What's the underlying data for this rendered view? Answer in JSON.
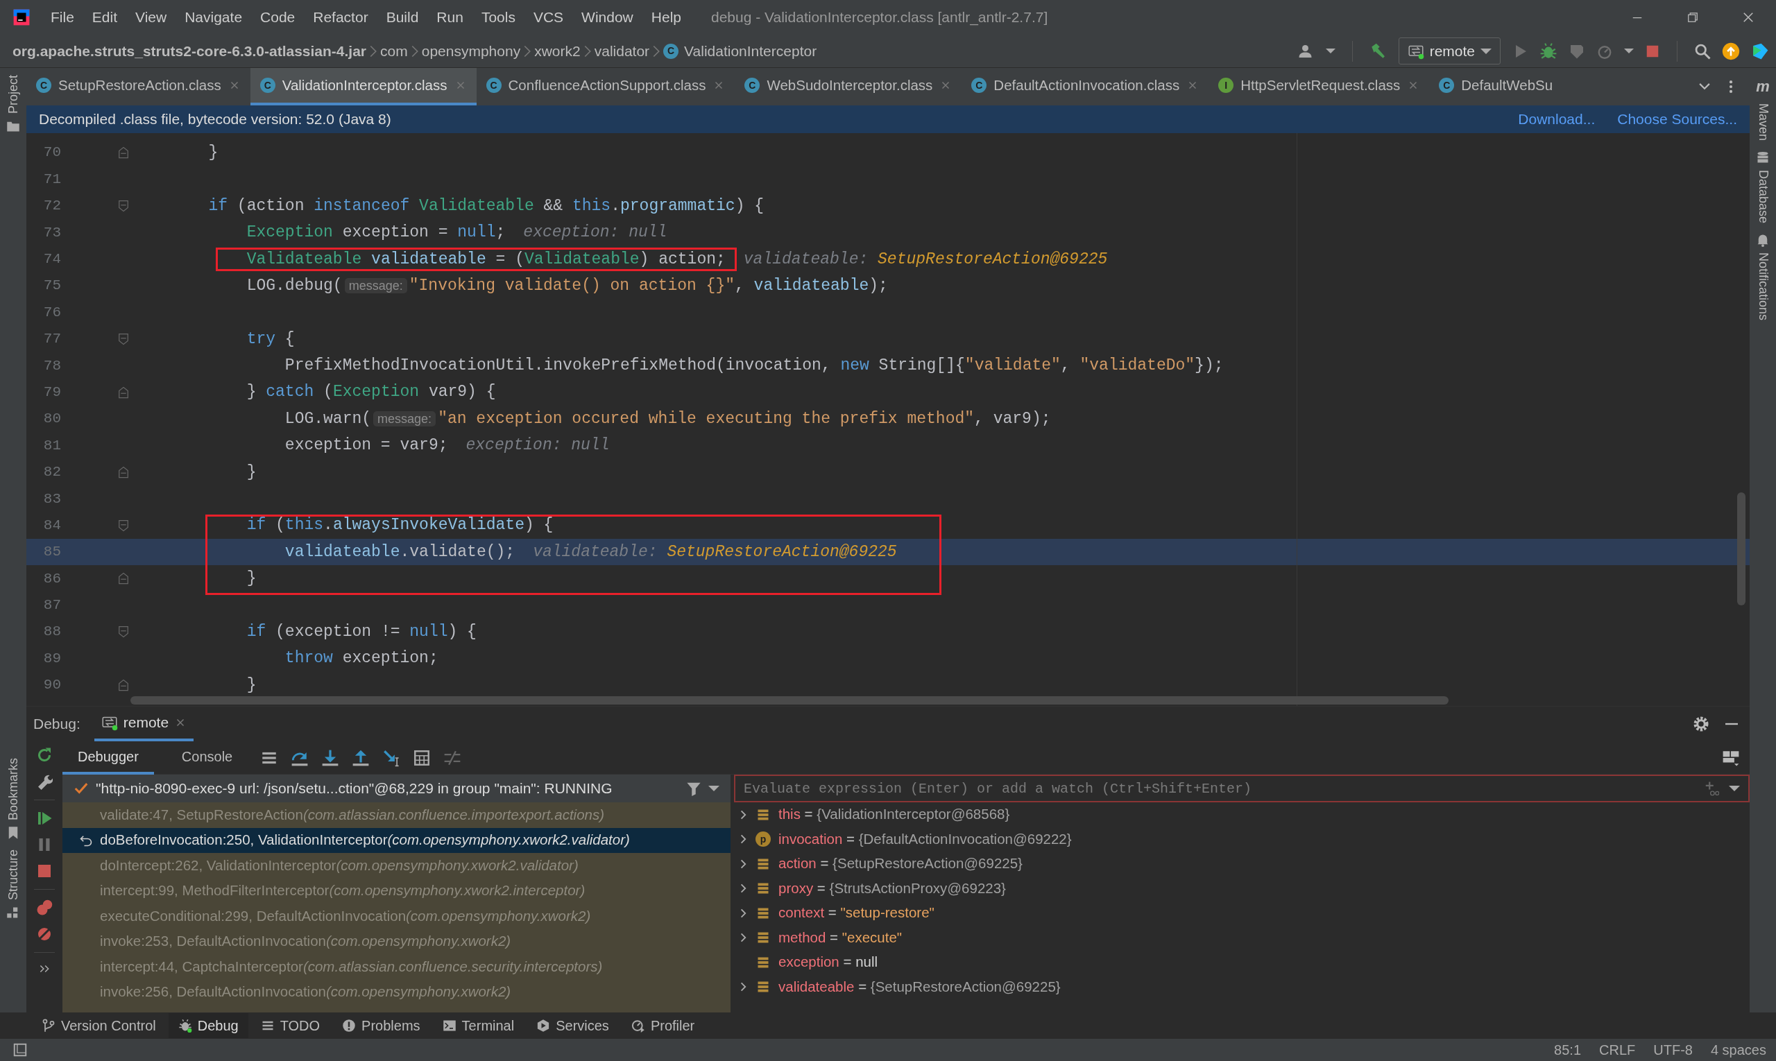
{
  "window": {
    "title": "debug - ValidationInterceptor.class [antlr_antlr-2.7.7]"
  },
  "menu": [
    "File",
    "Edit",
    "View",
    "Navigate",
    "Code",
    "Refactor",
    "Build",
    "Run",
    "Tools",
    "VCS",
    "Window",
    "Help"
  ],
  "breadcrumb": [
    {
      "label": "org.apache.struts_struts2-core-6.3.0-atlassian-4.jar"
    },
    {
      "label": "com"
    },
    {
      "label": "opensymphony"
    },
    {
      "label": "xwork2"
    },
    {
      "label": "validator"
    },
    {
      "label": "ValidationInterceptor",
      "kind": "class",
      "icon_letter": "C"
    }
  ],
  "run_config": "remote",
  "editor_tabs": [
    {
      "label": "SetupRestoreAction.class",
      "kind": "class",
      "icon_letter": "C",
      "selected": false,
      "closable": true
    },
    {
      "label": "ValidationInterceptor.class",
      "kind": "class",
      "icon_letter": "C",
      "selected": true,
      "closable": true
    },
    {
      "label": "ConfluenceActionSupport.class",
      "kind": "class",
      "icon_letter": "C",
      "selected": false,
      "closable": true
    },
    {
      "label": "WebSudoInterceptor.class",
      "kind": "class",
      "icon_letter": "C",
      "selected": false,
      "closable": true
    },
    {
      "label": "DefaultActionInvocation.class",
      "kind": "class",
      "icon_letter": "C",
      "selected": false,
      "closable": true
    },
    {
      "label": "HttpServletRequest.class",
      "kind": "interface",
      "icon_letter": "I",
      "selected": false,
      "closable": true
    },
    {
      "label": "DefaultWebSu",
      "kind": "class",
      "icon_letter": "C",
      "selected": false,
      "closable": false
    }
  ],
  "banner": {
    "text": "Decompiled .class file, bytecode version: 52.0 (Java 8)",
    "links": [
      "Download...",
      "Choose Sources..."
    ]
  },
  "code_lines": [
    {
      "number": "70",
      "fold_start": false,
      "fold_end": true,
      "current": false,
      "boxed": false,
      "tokens": [
        {
          "kind": "plain",
          "text": "        }"
        }
      ]
    },
    {
      "number": "71",
      "fold_start": false,
      "fold_end": false,
      "current": false,
      "boxed": false
    },
    {
      "number": "72",
      "fold_start": true,
      "fold_end": false,
      "current": false,
      "boxed": false,
      "tokens": [
        {
          "kind": "keyword",
          "text": "        if"
        },
        {
          "kind": "plain",
          "text": " (action "
        },
        {
          "kind": "keyword",
          "text": "instanceof "
        },
        {
          "kind": "type",
          "text": "Validateable"
        },
        {
          "kind": "plain",
          "text": " && "
        },
        {
          "kind": "keyword",
          "text": "this"
        },
        {
          "kind": "plain",
          "text": "."
        },
        {
          "kind": "field",
          "text": "programmatic"
        },
        {
          "kind": "plain",
          "text": ") {"
        }
      ]
    },
    {
      "number": "73",
      "fold_start": false,
      "fold_end": false,
      "current": false,
      "boxed": false,
      "tokens": [
        {
          "kind": "type",
          "text": "            Exception"
        },
        {
          "kind": "plain",
          "text": " exception = "
        },
        {
          "kind": "keyword",
          "text": "null"
        },
        {
          "kind": "plain",
          "text": ";"
        },
        {
          "kind": "inlay",
          "text": "exception: null"
        }
      ]
    },
    {
      "number": "74",
      "fold_start": false,
      "fold_end": false,
      "current": false,
      "boxed": true,
      "tokens": [
        {
          "kind": "type",
          "text": "            Validateable "
        },
        {
          "kind": "field",
          "text": "validateable"
        },
        {
          "kind": "plain",
          "text": " = ("
        },
        {
          "kind": "type",
          "text": "Validateable"
        },
        {
          "kind": "plain",
          "text": ") action;"
        },
        {
          "kind": "inlay",
          "text": "validateable:"
        },
        {
          "kind": "inlay_value",
          "text": "SetupRestoreAction@69225"
        }
      ]
    },
    {
      "number": "75",
      "fold_start": false,
      "fold_end": false,
      "current": false,
      "boxed": false,
      "tokens": [
        {
          "kind": "plain",
          "text": "            LOG.debug("
        },
        {
          "kind": "param",
          "text": "message:"
        },
        {
          "kind": "string",
          "text": "\"Invoking validate() on action {}\""
        },
        {
          "kind": "plain",
          "text": ", "
        },
        {
          "kind": "field",
          "text": "validateable"
        },
        {
          "kind": "plain",
          "text": ");"
        }
      ]
    },
    {
      "number": "76",
      "fold_start": false,
      "fold_end": false,
      "current": false,
      "boxed": false
    },
    {
      "number": "77",
      "fold_start": true,
      "fold_end": false,
      "current": false,
      "boxed": false,
      "tokens": [
        {
          "kind": "keyword",
          "text": "            try"
        },
        {
          "kind": "plain",
          "text": " {"
        }
      ]
    },
    {
      "number": "78",
      "fold_start": false,
      "fold_end": false,
      "current": false,
      "boxed": false,
      "tokens": [
        {
          "kind": "plain",
          "text": "                PrefixMethodInvocationUtil.invokePrefixMethod(invocation, "
        },
        {
          "kind": "keyword",
          "text": "new"
        },
        {
          "kind": "plain",
          "text": " String[]{"
        },
        {
          "kind": "string",
          "text": "\"validate\""
        },
        {
          "kind": "plain",
          "text": ", "
        },
        {
          "kind": "string",
          "text": "\"validateDo\""
        },
        {
          "kind": "plain",
          "text": "});"
        }
      ]
    },
    {
      "number": "79",
      "fold_start": false,
      "fold_end": true,
      "current": false,
      "boxed": false,
      "tokens": [
        {
          "kind": "plain",
          "text": "            } "
        },
        {
          "kind": "keyword",
          "text": "catch"
        },
        {
          "kind": "plain",
          "text": " ("
        },
        {
          "kind": "type",
          "text": "Exception"
        },
        {
          "kind": "plain",
          "text": " var9) {"
        }
      ]
    },
    {
      "number": "80",
      "fold_start": false,
      "fold_end": false,
      "current": false,
      "boxed": false,
      "tokens": [
        {
          "kind": "plain",
          "text": "                LOG.warn("
        },
        {
          "kind": "param",
          "text": "message:"
        },
        {
          "kind": "string",
          "text": "\"an exception occured while executing the prefix method\""
        },
        {
          "kind": "plain",
          "text": ", var9);"
        }
      ]
    },
    {
      "number": "81",
      "fold_start": false,
      "fold_end": false,
      "current": false,
      "boxed": false,
      "tokens": [
        {
          "kind": "plain",
          "text": "                exception = var9;"
        },
        {
          "kind": "inlay",
          "text": "exception: null"
        }
      ]
    },
    {
      "number": "82",
      "fold_start": false,
      "fold_end": true,
      "current": false,
      "boxed": false,
      "tokens": [
        {
          "kind": "plain",
          "text": "            }"
        }
      ]
    },
    {
      "number": "83",
      "fold_start": false,
      "fold_end": false,
      "current": false,
      "boxed": false
    },
    {
      "number": "84",
      "fold_start": true,
      "fold_end": false,
      "current": false,
      "boxed": true,
      "tokens": [
        {
          "kind": "keyword",
          "text": "            if"
        },
        {
          "kind": "plain",
          "text": " ("
        },
        {
          "kind": "keyword",
          "text": "this"
        },
        {
          "kind": "plain",
          "text": "."
        },
        {
          "kind": "field",
          "text": "alwaysInvokeValidate"
        },
        {
          "kind": "plain",
          "text": ") {"
        }
      ]
    },
    {
      "number": "85",
      "fold_start": false,
      "fold_end": false,
      "current": true,
      "boxed": true,
      "tokens": [
        {
          "kind": "field",
          "text": "                validateable"
        },
        {
          "kind": "plain",
          "text": ".validate();"
        },
        {
          "kind": "inlay",
          "text": "validateable:"
        },
        {
          "kind": "inlay_value",
          "text": "SetupRestoreAction@69225"
        }
      ]
    },
    {
      "number": "86",
      "fold_start": false,
      "fold_end": true,
      "current": false,
      "boxed": true,
      "tokens": [
        {
          "kind": "plain",
          "text": "            }"
        }
      ]
    },
    {
      "number": "87",
      "fold_start": false,
      "fold_end": false,
      "current": false,
      "boxed": false
    },
    {
      "number": "88",
      "fold_start": true,
      "fold_end": false,
      "current": false,
      "boxed": false,
      "tokens": [
        {
          "kind": "keyword",
          "text": "            if"
        },
        {
          "kind": "plain",
          "text": " (exception != "
        },
        {
          "kind": "keyword",
          "text": "null"
        },
        {
          "kind": "plain",
          "text": ") {"
        }
      ]
    },
    {
      "number": "89",
      "fold_start": false,
      "fold_end": false,
      "current": false,
      "boxed": false,
      "tokens": [
        {
          "kind": "keyword",
          "text": "                throw"
        },
        {
          "kind": "plain",
          "text": " exception;"
        }
      ]
    },
    {
      "number": "90",
      "fold_start": false,
      "fold_end": true,
      "current": false,
      "boxed": false,
      "tokens": [
        {
          "kind": "plain",
          "text": "            }"
        }
      ]
    }
  ],
  "left_stripe_top": [
    {
      "label": "Project",
      "kind": "project"
    }
  ],
  "left_stripe_bottom": [
    {
      "label": "Bookmarks",
      "kind": "bookmarks"
    },
    {
      "label": "Structure",
      "kind": "structure"
    }
  ],
  "right_stripe": [
    {
      "label": "Maven",
      "kind": "maven",
      "icon_letter": "m"
    },
    {
      "label": "Database",
      "kind": "database"
    },
    {
      "label": "Notifications",
      "kind": "notifications"
    }
  ],
  "debug": {
    "label": "Debug:",
    "session_tab": "remote",
    "tabs": [
      {
        "label": "Debugger",
        "selected": true
      },
      {
        "label": "Console",
        "selected": false
      }
    ],
    "thread": "\"http-nio-8090-exec-9 url: /json/setu...ction\"@68,229 in group \"main\": RUNNING",
    "frames": [
      {
        "location": "validate:47, SetupRestoreAction",
        "package": "(com.atlassian.confluence.importexport.actions)",
        "selected": false
      },
      {
        "location": "doBeforeInvocation:250, ValidationInterceptor",
        "package": "(com.opensymphony.xwork2.validator)",
        "selected": true
      },
      {
        "location": "doIntercept:262, ValidationInterceptor",
        "package": "(com.opensymphony.xwork2.validator)",
        "selected": false
      },
      {
        "location": "intercept:99, MethodFilterInterceptor",
        "package": "(com.opensymphony.xwork2.interceptor)",
        "selected": false
      },
      {
        "location": "executeConditional:299, DefaultActionInvocation",
        "package": "(com.opensymphony.xwork2)",
        "selected": false
      },
      {
        "location": "invoke:253, DefaultActionInvocation",
        "package": "(com.opensymphony.xwork2)",
        "selected": false
      },
      {
        "location": "intercept:44, CaptchaInterceptor",
        "package": "(com.atlassian.confluence.security.interceptors)",
        "selected": false
      },
      {
        "location": "invoke:256, DefaultActionInvocation",
        "package": "(com.opensymphony.xwork2)",
        "selected": false
      }
    ],
    "watch_placeholder": "Evaluate expression (Enter) or add a watch (Ctrl+Shift+Enter)",
    "variables": [
      {
        "name": "this",
        "separator": "=",
        "value": {
          "text": "{ValidationInterceptor@68568}",
          "kind": "object"
        },
        "kind": "field",
        "expandable": true
      },
      {
        "name": "invocation",
        "separator": "=",
        "value": {
          "text": "{DefaultActionInvocation@69222}",
          "kind": "object"
        },
        "kind": "param",
        "icon_letter": "p",
        "expandable": true
      },
      {
        "name": "action",
        "separator": "=",
        "value": {
          "text": "{SetupRestoreAction@69225}",
          "kind": "object"
        },
        "kind": "field",
        "expandable": true
      },
      {
        "name": "proxy",
        "separator": "=",
        "value": {
          "text": "{StrutsActionProxy@69223}",
          "kind": "object"
        },
        "kind": "field",
        "expandable": true
      },
      {
        "name": "context",
        "separator": "=",
        "value": {
          "text": "\"setup-restore\"",
          "kind": "string"
        },
        "kind": "field",
        "expandable": true
      },
      {
        "name": "method",
        "separator": "=",
        "value": {
          "text": "\"execute\"",
          "kind": "string"
        },
        "kind": "field",
        "expandable": true
      },
      {
        "name": "exception",
        "separator": "=",
        "value": {
          "text": "null",
          "kind": "null"
        },
        "kind": "field",
        "expandable": false
      },
      {
        "name": "validateable",
        "separator": "=",
        "value": {
          "text": "{SetupRestoreAction@69225}",
          "kind": "object"
        },
        "kind": "field",
        "expandable": true
      }
    ]
  },
  "tool_windows": [
    {
      "label": "Version Control",
      "kind": "vcs",
      "selected": false
    },
    {
      "label": "Debug",
      "kind": "debug",
      "selected": true
    },
    {
      "label": "TODO",
      "kind": "todo",
      "selected": false
    },
    {
      "label": "Problems",
      "kind": "problems",
      "selected": false
    },
    {
      "label": "Terminal",
      "kind": "terminal",
      "selected": false
    },
    {
      "label": "Services",
      "kind": "services",
      "selected": false
    },
    {
      "label": "Profiler",
      "kind": "profiler",
      "selected": false
    }
  ],
  "status_bar": [
    "85:1",
    "CRLF",
    "UTF-8",
    "4 spaces"
  ]
}
